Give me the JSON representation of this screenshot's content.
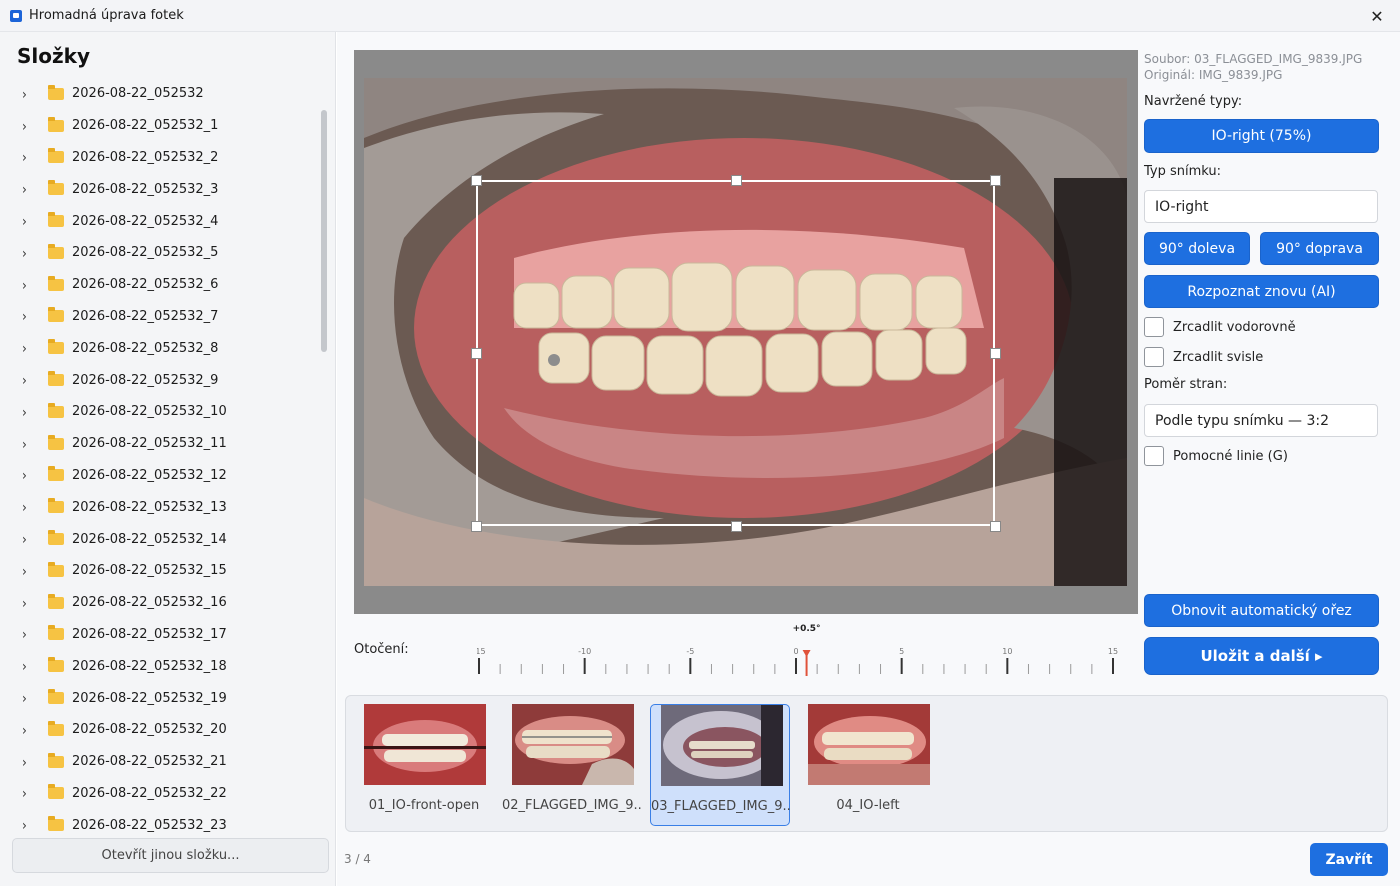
{
  "window": {
    "title": "Hromadná úprava fotek",
    "close_glyph": "✕"
  },
  "sidebar": {
    "heading": "Složky",
    "chevron": "›",
    "folders": [
      "2026-08-22_052532",
      "2026-08-22_052532_1",
      "2026-08-22_052532_2",
      "2026-08-22_052532_3",
      "2026-08-22_052532_4",
      "2026-08-22_052532_5",
      "2026-08-22_052532_6",
      "2026-08-22_052532_7",
      "2026-08-22_052532_8",
      "2026-08-22_052532_9",
      "2026-08-22_052532_10",
      "2026-08-22_052532_11",
      "2026-08-22_052532_12",
      "2026-08-22_052532_13",
      "2026-08-22_052532_14",
      "2026-08-22_052532_15",
      "2026-08-22_052532_16",
      "2026-08-22_052532_17",
      "2026-08-22_052532_18",
      "2026-08-22_052532_19",
      "2026-08-22_052532_20",
      "2026-08-22_052532_21",
      "2026-08-22_052532_22",
      "2026-08-22_052532_23"
    ],
    "open_other_label": "Otevřít jinou složku..."
  },
  "details": {
    "file": "Soubor: 03_FLAGGED_IMG_9839.JPG",
    "original": "Originál: IMG_9839.JPG",
    "suggested_label": "Navržené typy:",
    "suggested_type": "IO-right  (75%)",
    "type_label": "Typ snímku:",
    "type_value": "IO-right",
    "rotate_left": "90° doleva",
    "rotate_right": "90° doprava",
    "redetect": "Rozpoznat znovu (AI)",
    "flip_h": "Zrcadlit vodorovně",
    "flip_v": "Zrcadlit svisle",
    "aspect_label": "Poměr stran:",
    "aspect_value": "Podle typu snímku — 3:2",
    "guides": "Pomocné linie (G)",
    "reset_crop": "Obnovit automatický ořez",
    "save_next": "Uložit a další ▸"
  },
  "rotation": {
    "label": "Otočení:",
    "value_label": "+0.5°",
    "value": 0.5,
    "min": -15,
    "max": 15,
    "tick_labels": [
      "-15",
      "-10",
      "-5",
      "0",
      "5",
      "10",
      "15"
    ],
    "marker_color": "#e0523a"
  },
  "thumbnails": [
    {
      "label": "01_IO-front-open",
      "selected": false
    },
    {
      "label": "02_FLAGGED_IMG_9...",
      "selected": false
    },
    {
      "label": "03_FLAGGED_IMG_9...",
      "selected": true
    },
    {
      "label": "04_IO-left",
      "selected": false
    }
  ],
  "footer": {
    "counter": "3 / 4",
    "close_label": "Zavřít"
  },
  "colors": {
    "accent": "#1e6fe0",
    "selection": "#cfe0fb",
    "folder": "#f6c343"
  }
}
